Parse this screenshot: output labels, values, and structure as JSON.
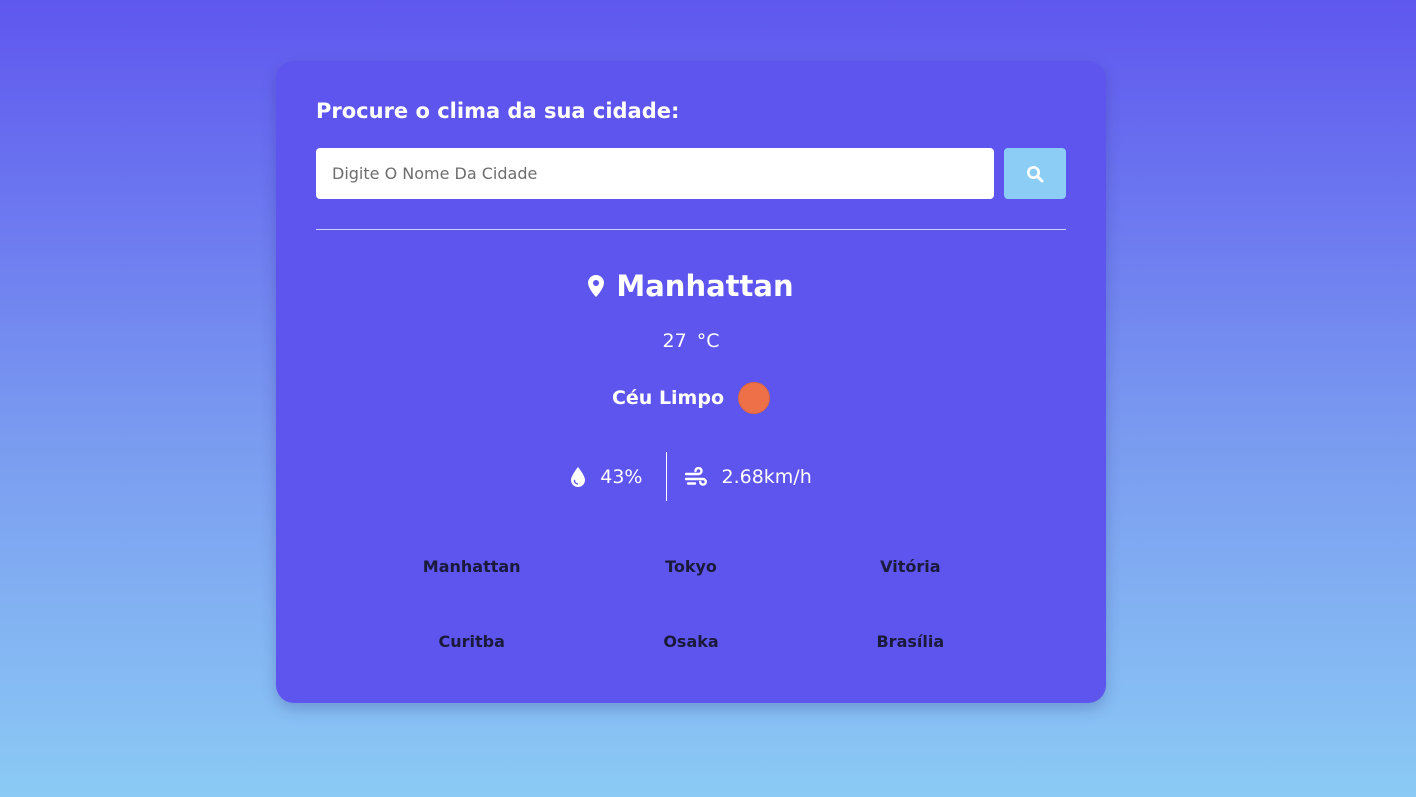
{
  "search": {
    "title": "Procure o clima da sua cidade:",
    "placeholder": "Digite O Nome Da Cidade",
    "value": "",
    "button_icon": "search-icon"
  },
  "weather": {
    "city": "Manhattan",
    "location_icon": "location-pin-icon",
    "temperature": "27",
    "unit": "°C",
    "description": "Céu Limpo",
    "icon": "sun-icon",
    "humidity": "43%",
    "humidity_icon": "water-drop-icon",
    "wind": "2.68km/h",
    "wind_icon": "wind-icon"
  },
  "suggestions": [
    "Manhattan",
    "Tokyo",
    "Vitória",
    "Curitba",
    "Osaka",
    "Brasília"
  ],
  "colors": {
    "card": "#5d55ee",
    "search_button": "#8bcdf4",
    "weather_icon": "#ee7048",
    "suggestion_text": "#1a1a3a"
  }
}
